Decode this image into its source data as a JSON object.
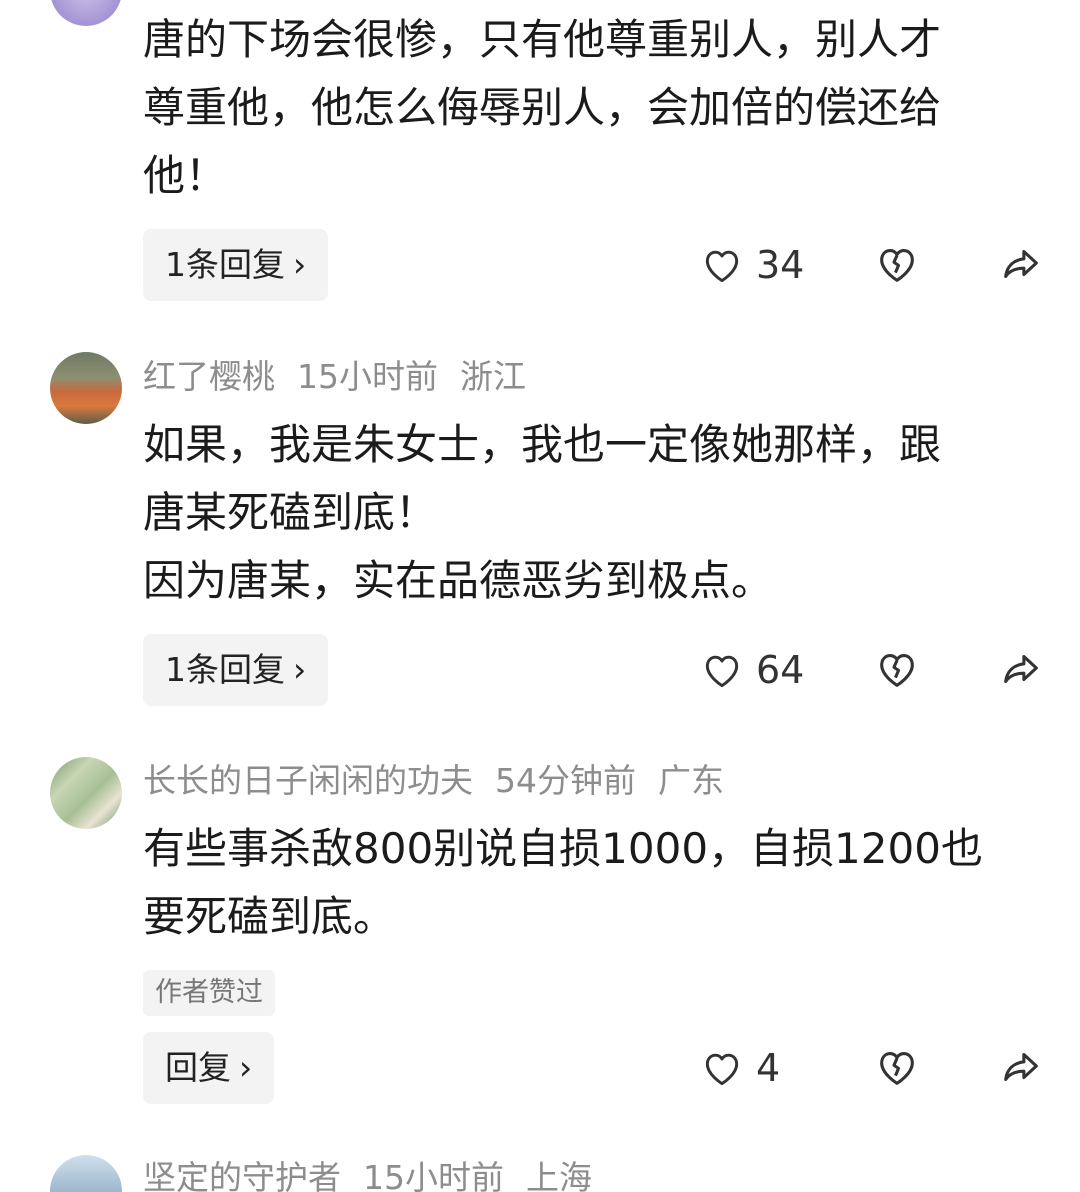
{
  "comments": [
    {
      "body_lines": [
        "唐的下场会很惨，只有他尊重别人，别人才",
        "尊重他，他怎么侮辱别人，会加倍的偿还给",
        "他！"
      ],
      "reply_label": "1条回复",
      "likes": "34"
    },
    {
      "username": "红了樱桃",
      "time": "15小时前",
      "location": "浙江",
      "body_lines": [
        "如果，我是朱女士，我也一定像她那样，跟",
        "唐某死磕到底！",
        "因为唐某，实在品德恶劣到极点。"
      ],
      "reply_label": "1条回复",
      "likes": "64"
    },
    {
      "username": "长长的日子闲闲的功夫",
      "time": "54分钟前",
      "location": "广东",
      "body_lines": [
        "有些事杀敌800别说自损1000，自损1200也",
        "要死磕到底。"
      ],
      "badge": "作者赞过",
      "reply_label": "回复",
      "likes": "4"
    },
    {
      "username": "坚定的守护者",
      "time": "15小时前",
      "location": "上海"
    }
  ],
  "icons": {
    "like": "heart-outline-icon",
    "dislike": "broken-heart-icon",
    "share": "share-arrow-icon",
    "chevron": "chevron-right-icon"
  },
  "colors": {
    "meta_text": "#8d8d8d",
    "reply_bg": "#f3f3f3",
    "icon_stroke": "#333333"
  }
}
